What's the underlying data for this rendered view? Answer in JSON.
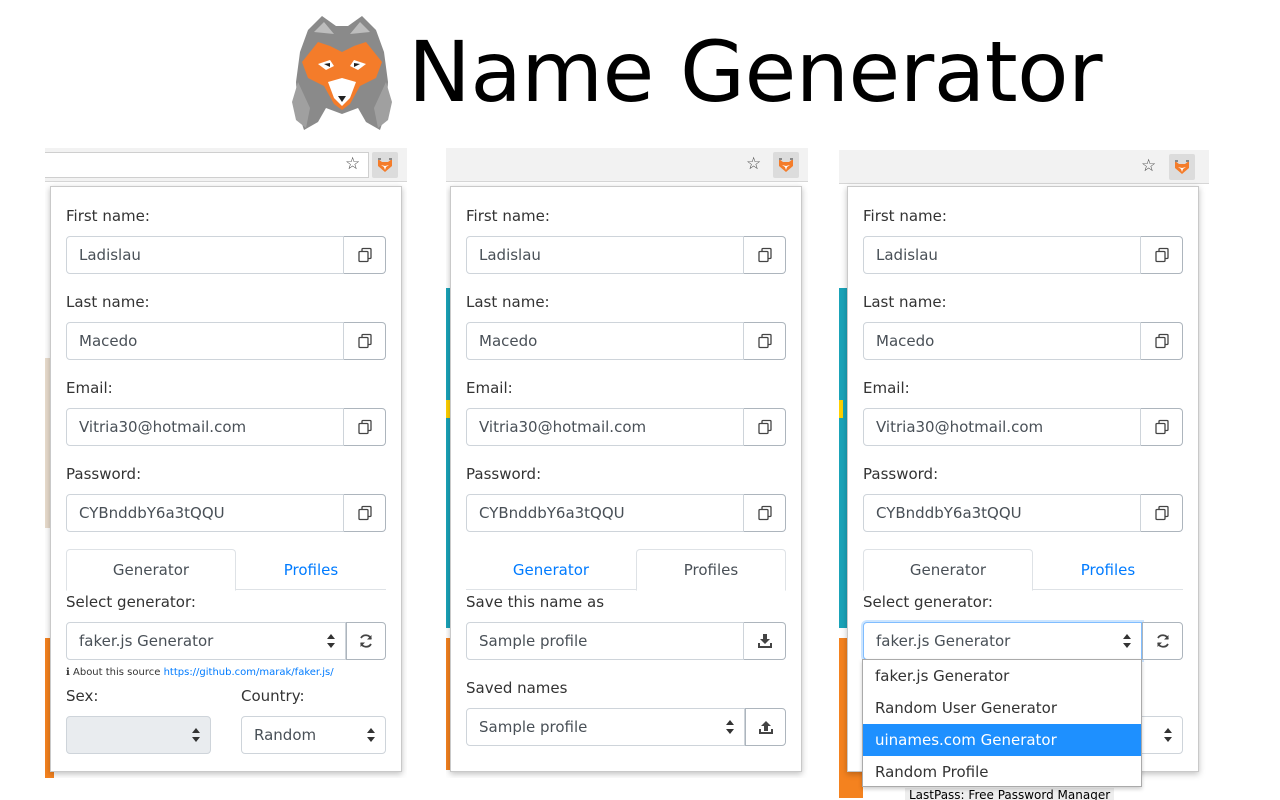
{
  "header": {
    "title": "Name Generator"
  },
  "icons": {
    "copy": "copy-icon",
    "refresh": "refresh-icon",
    "download": "download-icon",
    "upload": "upload-icon",
    "star": "star-icon",
    "fox": "fox-logo"
  },
  "colors": {
    "accent": "#007bff",
    "highlight": "#1e90ff",
    "fox_orange": "#f47c2a"
  },
  "fields": {
    "first_name_label": "First name:",
    "first_name_value": "Ladislau",
    "last_name_label": "Last name:",
    "last_name_value": "Macedo",
    "email_label": "Email:",
    "email_value": "Vitria30@hotmail.com",
    "password_label": "Password:",
    "password_value": "CYBnddbY6a3tQQU"
  },
  "tabs": {
    "generator": "Generator",
    "profiles": "Profiles"
  },
  "generator": {
    "select_label": "Select generator:",
    "selected": "faker.js Generator",
    "about_prefix": "About this source",
    "about_link": "https://github.com/marak/faker.js/",
    "sex_label": "Sex:",
    "sex_value": "",
    "country_label": "Country:",
    "country_value": "Random",
    "options": [
      "faker.js Generator",
      "Random User Generator",
      "uinames.com Generator",
      "Random Profile"
    ]
  },
  "profiles": {
    "save_label": "Save this name as",
    "save_value": "Sample profile",
    "saved_label": "Saved names",
    "saved_value": "Sample profile"
  },
  "background": {
    "lastpass_text": "LastPass: Free Password Manager"
  }
}
